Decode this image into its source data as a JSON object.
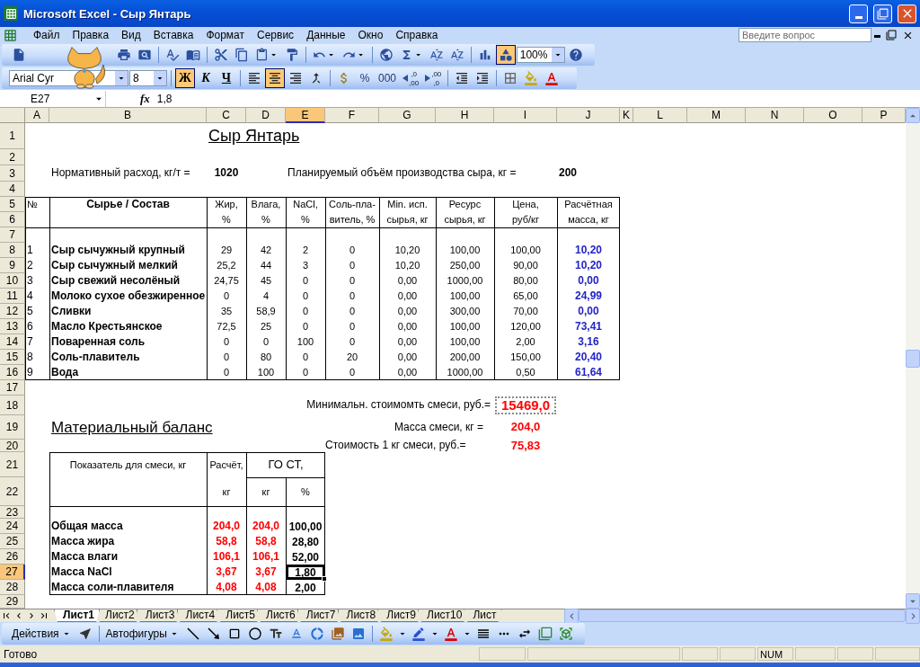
{
  "window": {
    "title": "Microsoft Excel - Сыр Янтарь"
  },
  "menu": [
    "Файл",
    "Правка",
    "Вид",
    "Вставка",
    "Формат",
    "Сервис",
    "Данные",
    "Окно",
    "Справка"
  ],
  "help_box": {
    "placeholder": "Введите вопрос"
  },
  "standard_toolbar": {
    "drawing_button": {
      "pressed": true
    },
    "zoom": "100%"
  },
  "formatting_toolbar": {
    "font": "Arial Cyr",
    "size": "8",
    "style_buttons": [
      {
        "label": "Ж",
        "kind": "bold",
        "pressed": true
      },
      {
        "label": "К",
        "kind": "italic",
        "pressed": false
      },
      {
        "label": "Ч",
        "kind": "underline",
        "pressed": false
      }
    ],
    "align_buttons": [
      {
        "kind": "left",
        "pressed": false
      },
      {
        "kind": "center",
        "pressed": true
      },
      {
        "kind": "right",
        "pressed": false
      },
      {
        "kind": "merge",
        "pressed": false
      }
    ],
    "number_buttons": [
      "%",
      "000"
    ],
    "decimal_buttons": [
      {
        "kind": "increase",
        "from": ",0",
        "to": ",00"
      },
      {
        "kind": "decrease",
        "from": ",00",
        "to": ",0"
      }
    ]
  },
  "formula_bar": {
    "cell": "E27",
    "fx": "fx",
    "value": "1,8"
  },
  "sheet": {
    "columns": [
      {
        "label": "A",
        "selected": false
      },
      {
        "label": "B",
        "selected": false
      },
      {
        "label": "C",
        "selected": false
      },
      {
        "label": "D",
        "selected": false
      },
      {
        "label": "E",
        "selected": true
      },
      {
        "label": "F",
        "selected": false
      },
      {
        "label": "G",
        "selected": false
      },
      {
        "label": "H",
        "selected": false
      },
      {
        "label": "I",
        "selected": false
      },
      {
        "label": "J",
        "selected": false
      },
      {
        "label": "K",
        "selected": false
      },
      {
        "label": "L",
        "selected": false
      },
      {
        "label": "M",
        "selected": false
      },
      {
        "label": "N",
        "selected": false
      },
      {
        "label": "O",
        "selected": false
      },
      {
        "label": "P",
        "selected": false
      }
    ],
    "rows": [
      {
        "label": "1",
        "selected": false
      },
      {
        "label": "2",
        "selected": false
      },
      {
        "label": "3",
        "selected": false
      },
      {
        "label": "4",
        "selected": false
      },
      {
        "label": "5",
        "selected": false
      },
      {
        "label": "6",
        "selected": false
      },
      {
        "label": "7",
        "selected": false
      },
      {
        "label": "8",
        "selected": false
      },
      {
        "label": "9",
        "selected": false
      },
      {
        "label": "10",
        "selected": false
      },
      {
        "label": "11",
        "selected": false
      },
      {
        "label": "12",
        "selected": false
      },
      {
        "label": "13",
        "selected": false
      },
      {
        "label": "14",
        "selected": false
      },
      {
        "label": "15",
        "selected": false
      },
      {
        "label": "16",
        "selected": false
      },
      {
        "label": "17",
        "selected": false
      },
      {
        "label": "18",
        "selected": false
      },
      {
        "label": "19",
        "selected": false
      },
      {
        "label": "20",
        "selected": false
      },
      {
        "label": "21",
        "selected": false
      },
      {
        "label": "22",
        "selected": false
      },
      {
        "label": "23",
        "selected": false
      },
      {
        "label": "24",
        "selected": false
      },
      {
        "label": "25",
        "selected": false
      },
      {
        "label": "26",
        "selected": false
      },
      {
        "label": "27",
        "selected": true
      },
      {
        "label": "28",
        "selected": false
      },
      {
        "label": "29",
        "selected": false
      }
    ],
    "title": "Сыр Янтарь",
    "norm": {
      "label": "Нормативный расход, кг/т =",
      "value": "1020"
    },
    "plan": {
      "label": "Планируемый объём производства сыра, кг =",
      "value": "200"
    },
    "ingredients": {
      "headers": [
        [
          "№"
        ],
        [
          "Сырье / Состав"
        ],
        [
          "Жир,",
          "%"
        ],
        [
          "Влага,",
          "%"
        ],
        [
          "NaCl,",
          "%"
        ],
        [
          "Соль-пла-",
          "витель, %"
        ],
        [
          "Min. исп.",
          "сырья, кг"
        ],
        [
          "Ресурс",
          "сырья, кг"
        ],
        [
          "Цена,",
          "руб/кг"
        ],
        [
          "Расчётная",
          "масса, кг"
        ]
      ],
      "rows": [
        [
          "1",
          "Сыр сычужный крупный",
          "29",
          "42",
          "2",
          "0",
          "10,20",
          "100,00",
          "100,00",
          "10,20"
        ],
        [
          "2",
          "Сыр сычужный мелкий",
          "25,2",
          "44",
          "3",
          "0",
          "10,20",
          "250,00",
          "90,00",
          "10,20"
        ],
        [
          "3",
          "Сыр свежий несолёный",
          "24,75",
          "45",
          "0",
          "0",
          "0,00",
          "1000,00",
          "80,00",
          "0,00"
        ],
        [
          "4",
          "Молоко сухое обезжиренное",
          "0",
          "4",
          "0",
          "0",
          "0,00",
          "100,00",
          "65,00",
          "24,99"
        ],
        [
          "5",
          "Сливки",
          "35",
          "58,9",
          "0",
          "0",
          "0,00",
          "300,00",
          "70,00",
          "0,00"
        ],
        [
          "6",
          "Масло Крестьянское",
          "72,5",
          "25",
          "0",
          "0",
          "0,00",
          "100,00",
          "120,00",
          "73,41"
        ],
        [
          "7",
          "Поваренная соль",
          "0",
          "0",
          "100",
          "0",
          "0,00",
          "100,00",
          "2,00",
          "3,16"
        ],
        [
          "8",
          "Соль-плавитель",
          "0",
          "80",
          "0",
          "20",
          "0,00",
          "200,00",
          "150,00",
          "20,40"
        ],
        [
          "9",
          "Вода",
          "0",
          "100",
          "0",
          "0",
          "0,00",
          "1000,00",
          "0,50",
          "61,64"
        ]
      ]
    },
    "results": [
      {
        "label": "Минимальн. стоимомть смеси, руб.=",
        "value": "15469,0",
        "kind": "marquee"
      },
      {
        "label": "Масса смеси, кг =",
        "value": "204,0",
        "kind": "plain"
      },
      {
        "label": "Стоимость 1 кг смеси, руб.=",
        "value": "75,83",
        "kind": "plain"
      }
    ],
    "balance": {
      "title": "Материальный баланс",
      "indicator_header": "Показатель для смеси, кг",
      "calc_header": [
        "Расчёт,",
        "кг"
      ],
      "gost_header": "ГО СТ,",
      "gost_units": [
        "кг",
        "%"
      ],
      "rows": [
        {
          "name": "Общая масса",
          "calc": "204,0",
          "gost_kg": "204,0",
          "gost_pct": "100,00",
          "selected": false
        },
        {
          "name": "Масса жира",
          "calc": "58,8",
          "gost_kg": "58,8",
          "gost_pct": "28,80",
          "selected": false
        },
        {
          "name": "Масса влаги",
          "calc": "106,1",
          "gost_kg": "106,1",
          "gost_pct": "52,00",
          "selected": false
        },
        {
          "name": "Масса NaCl",
          "calc": "3,67",
          "gost_kg": "3,67",
          "gost_pct": "1,80",
          "selected": true
        },
        {
          "name": "Масса соли-плавителя",
          "calc": "4,08",
          "gost_kg": "4,08",
          "gost_pct": "2,00",
          "selected": false
        }
      ]
    }
  },
  "sheet_tabs": [
    {
      "label": "Лист1",
      "selected": true
    },
    {
      "label": "Лист2",
      "selected": false
    },
    {
      "label": "Лист3",
      "selected": false
    },
    {
      "label": "Лист4",
      "selected": false
    },
    {
      "label": "Лист5",
      "selected": false
    },
    {
      "label": "Лист6",
      "selected": false
    },
    {
      "label": "Лист7",
      "selected": false
    },
    {
      "label": "Лист8",
      "selected": false
    },
    {
      "label": "Лист9",
      "selected": false
    },
    {
      "label": "Лист10",
      "selected": false
    },
    {
      "label": "Лист",
      "selected": false
    }
  ],
  "drawing_toolbar": {
    "actions": "Действия",
    "autoshapes": "Автофигуры"
  },
  "status_bar": {
    "status": "Готово",
    "indicator": "NUM"
  }
}
